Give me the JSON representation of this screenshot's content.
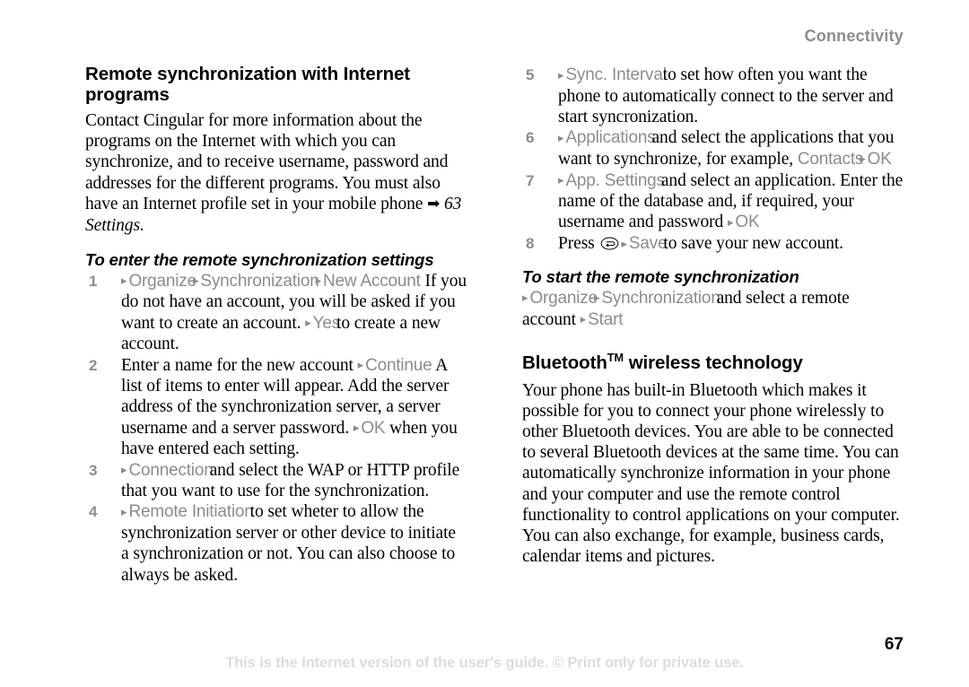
{
  "header": {
    "chapter": "Connectivity"
  },
  "footer": {
    "notice": "This is the Internet version of the user's guide. © Print only for private use.",
    "page_number": "67"
  },
  "left_column": {
    "section_heading": "Remote synchronization with Internet programs",
    "intro_text_1": "Contact Cingular for more information about the programs on the Internet with which you can synchronize, and to receive username, password and addresses for the different programs. You must also have an Internet profile set in your mobile phone ",
    "xref_arrow": "➡",
    "xref_label": "63 Settings.",
    "procedure_heading": "To enter the remote synchronization settings",
    "steps": [
      {
        "number": "1",
        "tri1": "▸",
        "menu1": "Organize",
        "tri2": "▸",
        "menu2": "Synchronization",
        "tri3": "▸",
        "menu3": "New Account",
        "text_after": "If you do not have an account, you will be asked if you want to create an account. ",
        "tri4": "▸",
        "menu4": "Yes",
        "text_tail": "to create a new account."
      },
      {
        "number": "2",
        "text_lead": "Enter a name for the new account ",
        "tri1": "▸",
        "menu1": "Continue",
        "text_after": "A list of items to enter will appear. Add the server address of the synchronization server, a server username and a server password. ",
        "tri2": "▸",
        "menu2": "OK",
        "text_tail": "when you have entered each setting."
      },
      {
        "number": "3",
        "tri1": "▸",
        "menu1": "Connection",
        "text_tail": "and select the WAP or HTTP profile that you want to use for the synchronization."
      },
      {
        "number": "4",
        "tri1": "▸",
        "menu1": "Remote Initiation",
        "text_tail": "to set wheter to allow the synchronization server or other device to initiate a synchronization or not. You can also choose to always be asked."
      }
    ]
  },
  "right_column": {
    "steps": [
      {
        "number": "5",
        "tri1": "▸",
        "menu1": "Sync. Interval",
        "text_tail": "to set how often you want the phone to automatically connect to the server and start syncronization."
      },
      {
        "number": "6",
        "tri1": "▸",
        "menu1": "Applications",
        "text_tail": "and select the applications that you want to synchronize, for example, ",
        "menu2": "Contacts",
        "tri2": "▸",
        "menu3": "OK"
      },
      {
        "number": "7",
        "tri1": "▸",
        "menu1": "App. Settings",
        "text_tail": "and select an application. Enter the name of the database and, if required, your username and password ",
        "tri2": "▸",
        "menu2": "OK"
      },
      {
        "number": "8",
        "text_lead": "Press ",
        "key_icon": "back-key",
        "tri1": "▸",
        "menu1": "Save",
        "text_tail": "to save your new account."
      }
    ],
    "procedure_heading": "To start the remote synchronization",
    "start_sync": {
      "tri1": "▸",
      "menu1": "Organize",
      "tri2": "▸",
      "menu2": "Synchronization",
      "text_mid": "and select a remote account ",
      "tri3": "▸",
      "menu3": "Start"
    },
    "bluetooth_heading_main": "Bluetooth",
    "bluetooth_heading_tm": "TM",
    "bluetooth_heading_rest": " wireless technology",
    "bluetooth_body": "Your phone has built-in Bluetooth which makes it possible for you to connect your phone wirelessly to other Bluetooth devices. You are able to be connected to several Bluetooth devices at the same time. You can automatically synchronize information in your phone and your computer and use the remote control functionality to control applications on your computer. You can also exchange, for example, business cards, calendar items and pictures."
  }
}
